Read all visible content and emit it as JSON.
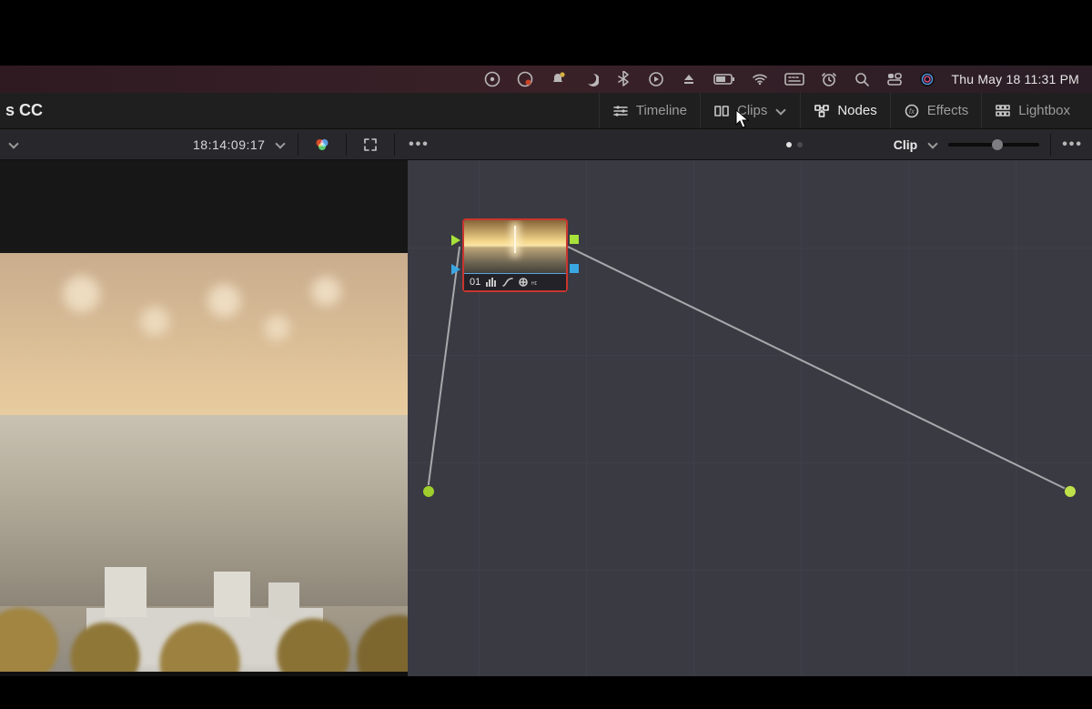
{
  "menubar": {
    "datetime": "Thu May 18  11:31 PM"
  },
  "app": {
    "title_suffix": "s CC"
  },
  "tabs": {
    "timeline": "Timeline",
    "clips": "Clips",
    "nodes": "Nodes",
    "effects": "Effects",
    "lightbox": "Lightbox"
  },
  "toolbar": {
    "timecode": "18:14:09:17",
    "clip_label": "Clip"
  },
  "node_editor": {
    "node1": {
      "number": "01"
    }
  }
}
